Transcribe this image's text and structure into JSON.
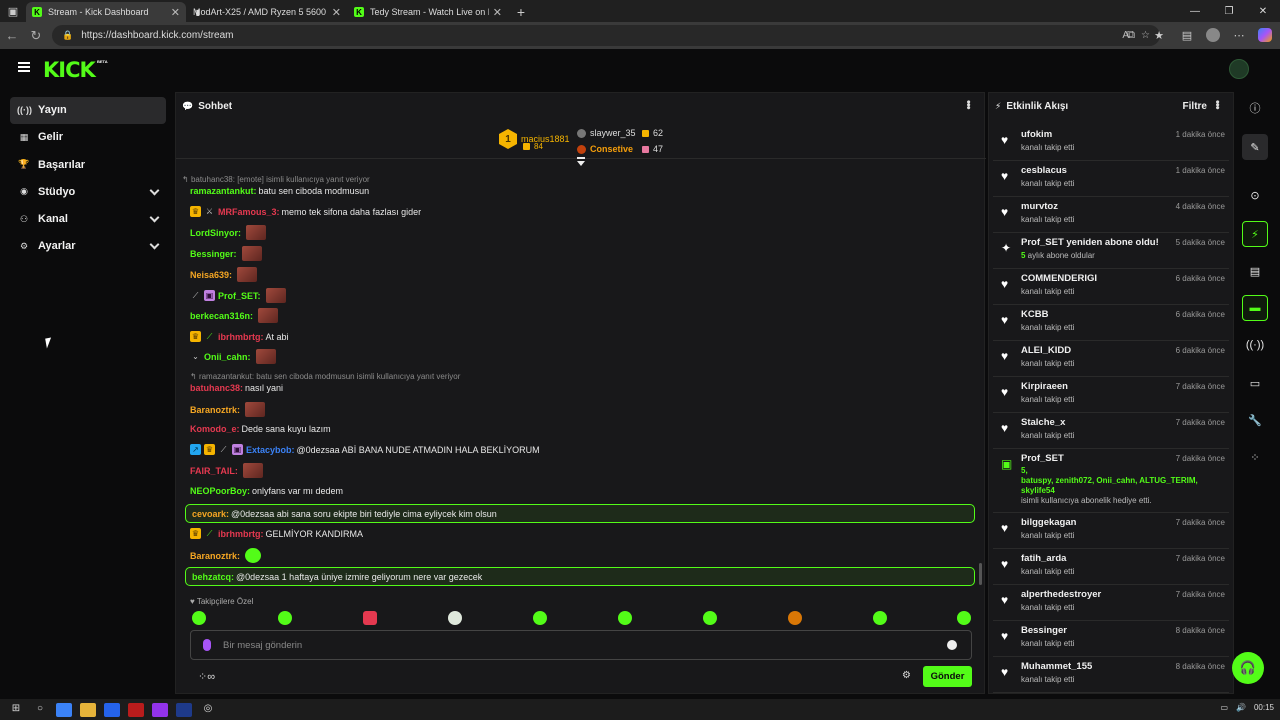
{
  "browser": {
    "tabs": [
      {
        "title": "Stream - Kick Dashboard",
        "active": true,
        "fav": "K"
      },
      {
        "title": "ModArt-X25 / AMD Ryzen 5 5600",
        "active": false,
        "fav": "M"
      },
      {
        "title": "Tedy Stream - Watch Live on Kick",
        "active": false,
        "fav": "K"
      }
    ],
    "url": "https://dashboard.kick.com/stream"
  },
  "app": {
    "logo": "KICK",
    "beta": "BETA"
  },
  "sidebar": {
    "items": [
      {
        "label": "Yayın",
        "icon": "broadcast-icon"
      },
      {
        "label": "Gelir",
        "icon": "revenue-icon"
      },
      {
        "label": "Başarılar",
        "icon": "trophy-icon"
      },
      {
        "label": "Stüdyo",
        "icon": "studio-icon"
      },
      {
        "label": "Kanal",
        "icon": "channel-icon"
      },
      {
        "label": "Ayarlar",
        "icon": "gear-icon"
      }
    ]
  },
  "chat": {
    "title": "Sohbet",
    "leaders": {
      "first": {
        "rank": "1",
        "name": "macius1881",
        "count": "84"
      },
      "second": {
        "name": "slaywer_35",
        "count": "62"
      },
      "third": {
        "name": "Consetive",
        "count": "47"
      }
    },
    "messages": [
      {
        "reply": "batuhanc38: [emote] isimli kullanıcıya yanıt veriyor"
      },
      {
        "user": "ramazantankut",
        "color": "#53fc18",
        "text": "batu sen ciboda modmusun"
      },
      {
        "user": "MRFamous_3",
        "color": "#e53950",
        "text": "memo tek sifona daha fazlası gider"
      },
      {
        "user": "LordSinyor",
        "color": "#53fc18",
        "text": ""
      },
      {
        "user": "Bessinger",
        "color": "#53fc18",
        "text": ""
      },
      {
        "user": "Neisa639",
        "color": "#f5a623",
        "text": ""
      },
      {
        "user": "Prof_SET",
        "color": "#53fc18",
        "text": ""
      },
      {
        "user": "berkecan316n",
        "color": "#53fc18",
        "text": ""
      },
      {
        "user": "ibrhmbrtg",
        "color": "#e53950",
        "text": "At abi"
      },
      {
        "user": "Onii_cahn",
        "color": "#53fc18",
        "text": ""
      },
      {
        "reply": "ramazantankut: batu sen ciboda modmusun isimli kullanıcıya yanıt veriyor"
      },
      {
        "user": "batuhanc38",
        "color": "#e53950",
        "text": "nasıl yani"
      },
      {
        "user": "Baranoztrk",
        "color": "#f5a623",
        "text": ""
      },
      {
        "user": "Komodo_e",
        "color": "#e53950",
        "text": "Dede sana kuyu lazım"
      },
      {
        "user": "Extacybob",
        "color": "#3b82f6",
        "text": "@0dezsaa ABİ BANA NUDE ATMADIN HALA BEKLİYORUM"
      },
      {
        "user": "FAIR_TAIL",
        "color": "#e53950",
        "text": ""
      },
      {
        "user": "NEOPoorBoy",
        "color": "#53fc18",
        "text": "onlyfans var mı dedem"
      },
      {
        "user": "cevoark",
        "color": "#f5a623",
        "text": "@0dezsaa abi sana soru ekipte biri tediyle cima eyliycek kim olsun"
      },
      {
        "user": "ibrhmbrtg",
        "color": "#e53950",
        "text": "GELMİYOR KANDIRMA"
      },
      {
        "user": "Baranoztrk",
        "color": "#f5a623",
        "text": ""
      },
      {
        "user": "behzatcq",
        "color": "#53fc18",
        "text": "@0dezsaa 1 haftaya üniye izmire geliyorum nere var gezecek"
      }
    ],
    "followers_only": "Takipçilere Özel",
    "input_placeholder": "Bir mesaj gönderin",
    "send_label": "Gönder"
  },
  "activity": {
    "title": "Etkinlik Akışı",
    "filter": "Filtre",
    "items": [
      {
        "name": "ufokim",
        "sub": "kanalı takip etti",
        "time": "1 dakika önce"
      },
      {
        "name": "cesblacus",
        "sub": "kanalı takip etti",
        "time": "1 dakika önce"
      },
      {
        "name": "murvtoz",
        "sub": "kanalı takip etti",
        "time": "4 dakika önce"
      },
      {
        "name": "Prof_SET yeniden abone oldu!",
        "sub_highlight": "5",
        "sub": " aylık abone oldular",
        "time": "5 dakika önce"
      },
      {
        "name": "COMMENDERIGI",
        "sub": "kanalı takip etti",
        "time": "6 dakika önce"
      },
      {
        "name": "KCBB",
        "sub": "kanalı takip etti",
        "time": "6 dakika önce"
      },
      {
        "name": "ALEI_KIDD",
        "sub": "kanalı takip etti",
        "time": "6 dakika önce"
      },
      {
        "name": "Kirpiraeen",
        "sub": "kanalı takip etti",
        "time": "7 dakika önce"
      },
      {
        "name": "Stalche_x",
        "sub": "kanalı takip etti",
        "time": "7 dakika önce"
      },
      {
        "name": "Prof_SET",
        "gift_count": "5,",
        "gift_users_1": "batuspy, zenith072, Onii_cahn, ALTUG_TERIM,",
        "gift_users_2": "skylife54",
        "sub": "isimli kullanıcıya abonelik hediye etti.",
        "time": "7 dakika önce"
      },
      {
        "name": "bilggekagan",
        "sub": "kanalı takip etti",
        "time": "7 dakika önce"
      },
      {
        "name": "fatih_arda",
        "sub": "kanalı takip etti",
        "time": "7 dakika önce"
      },
      {
        "name": "alperthedestroyer",
        "sub": "kanalı takip etti",
        "time": "7 dakika önce"
      },
      {
        "name": "Bessinger",
        "sub": "kanalı takip etti",
        "time": "8 dakika önce"
      },
      {
        "name": "Muhammet_155",
        "sub": "kanalı takip etti",
        "time": "8 dakika önce"
      }
    ]
  },
  "taskbar": {
    "time": "00:15"
  }
}
